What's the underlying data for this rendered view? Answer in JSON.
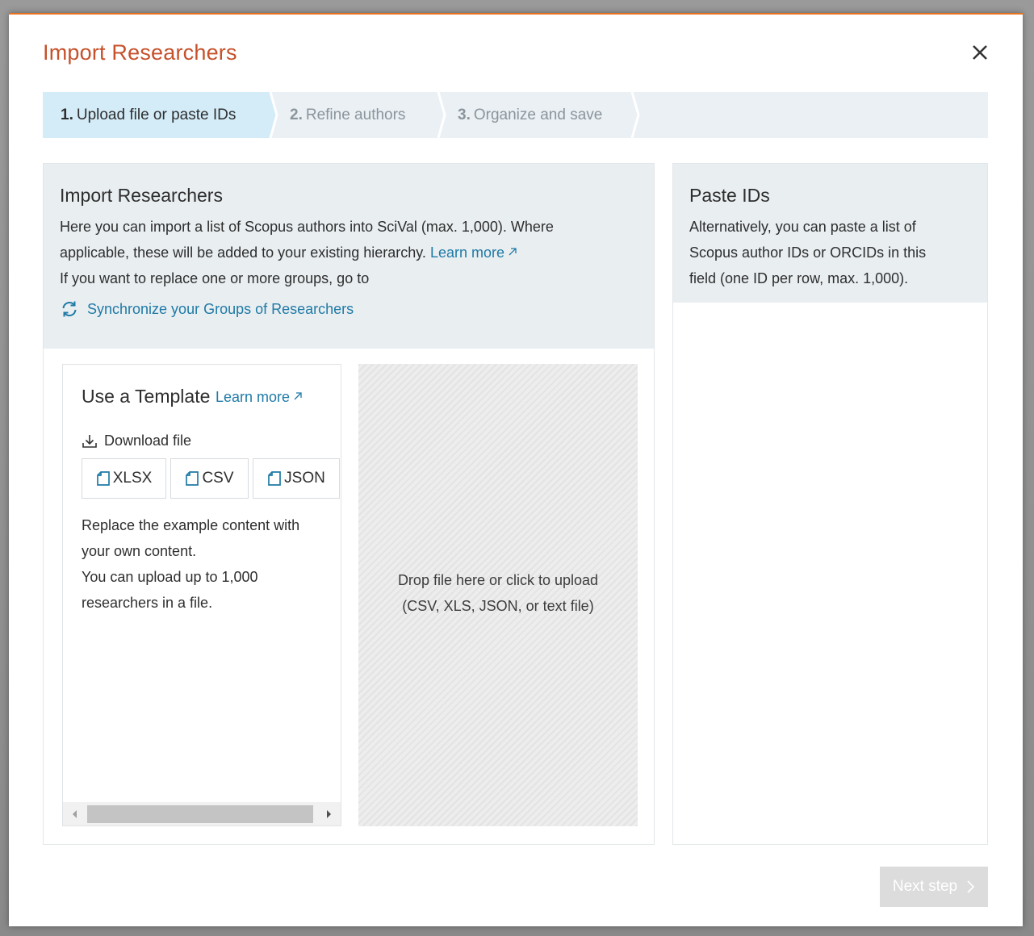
{
  "modal": {
    "title": "Import Researchers",
    "accent_color": "#e9711c",
    "title_color": "#c6512b",
    "close_icon": "close-icon"
  },
  "stepper": {
    "steps": [
      {
        "number": "1.",
        "label": "Upload file or paste IDs",
        "state": "active"
      },
      {
        "number": "2.",
        "label": "Refine authors",
        "state": "inactive"
      },
      {
        "number": "3.",
        "label": "Organize and save",
        "state": "inactive"
      }
    ]
  },
  "import_panel": {
    "title": "Import Researchers",
    "line1": "Here you can import a list of Scopus authors into SciVal (max. 1,000). Where",
    "line2": "applicable, these will be added to your existing hierarchy.",
    "learn_more": "Learn more",
    "line3": "If you want to replace one or more groups, go to",
    "sync_link": "Synchronize your Groups of Researchers",
    "link_color": "#1f7aa6"
  },
  "template": {
    "title": "Use a Template",
    "learn_more": "Learn more",
    "download_label": "Download file",
    "formats": [
      "XLSX",
      "CSV",
      "JSON"
    ],
    "text_line1": "Replace the example content with",
    "text_line2": "your own content.",
    "text_line3": "You can upload up to 1,000",
    "text_line4": "researchers in a file."
  },
  "dropzone": {
    "line1": "Drop file here or click to upload",
    "line2": "(CSV, XLS, JSON, or text file)"
  },
  "paste_panel": {
    "title": "Paste IDs",
    "line1": "Alternatively, you can paste a list of",
    "line2": "Scopus author IDs or ORCIDs in this",
    "line3": "field (one ID per row, max. 1,000).",
    "value": ""
  },
  "footer": {
    "next_label": "Next step"
  }
}
